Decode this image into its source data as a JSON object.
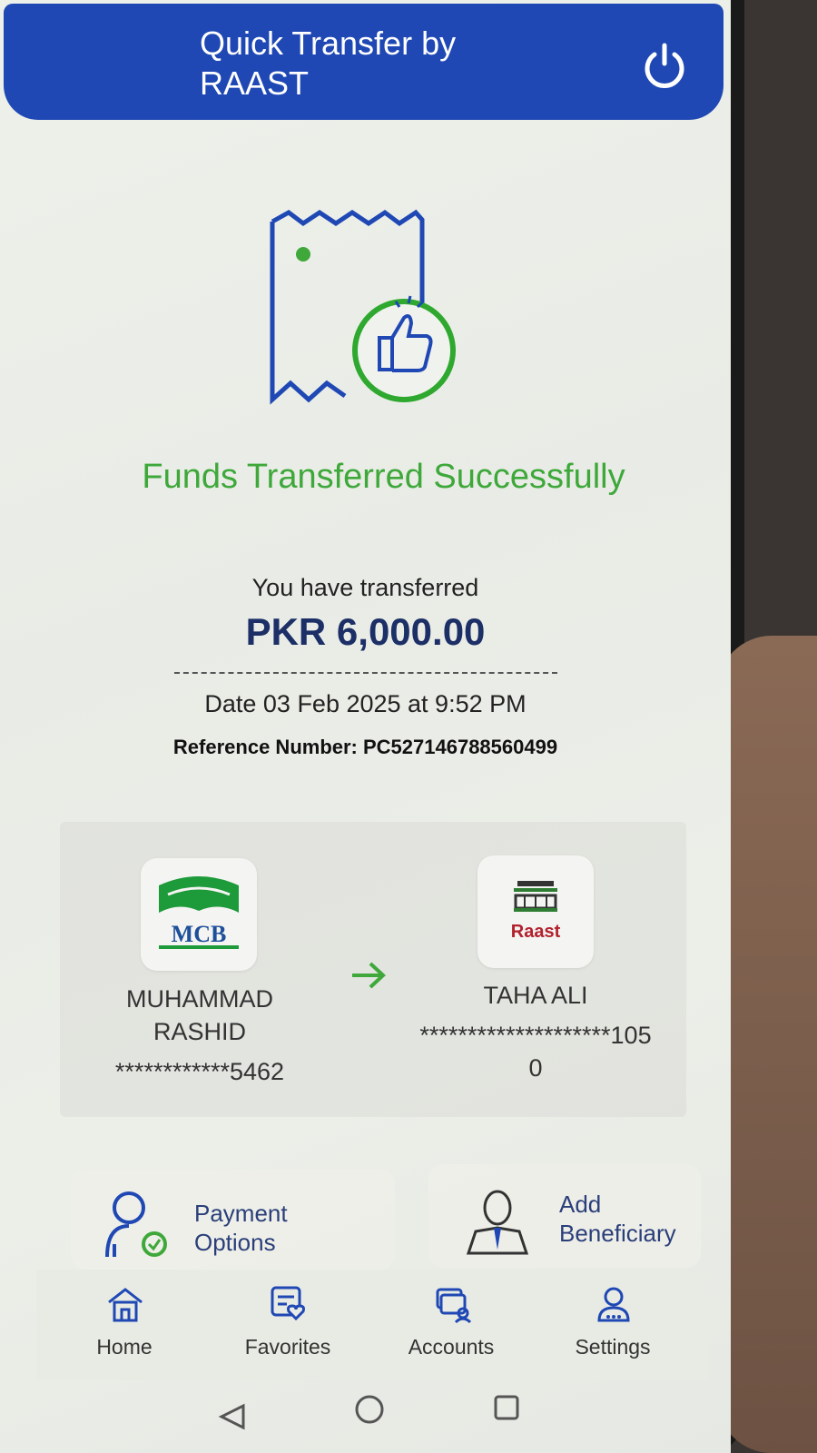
{
  "header": {
    "title": "Quick Transfer by RAAST",
    "power_icon": "power-icon"
  },
  "status": {
    "message": "Funds Transferred Successfully",
    "color": "#3ea83a"
  },
  "transfer": {
    "label": "You have transferred",
    "amount": "PKR 6,000.00",
    "date": "Date 03 Feb 2025 at 9:52 PM",
    "reference": "Reference Number: PC527146788560499"
  },
  "sender": {
    "bank": "MCB",
    "name": "MUHAMMAD RASHID",
    "account": "************5462"
  },
  "receiver": {
    "bank": "Raast",
    "name": "TAHA ALI",
    "account": "********************1050"
  },
  "actions": [
    {
      "label": "Payment Options",
      "icon": "payment-options-icon"
    },
    {
      "label": "Add Beneficiary",
      "icon": "add-beneficiary-icon"
    }
  ],
  "nav": [
    {
      "label": "Home",
      "icon": "home-icon"
    },
    {
      "label": "Favorites",
      "icon": "favorites-icon"
    },
    {
      "label": "Accounts",
      "icon": "accounts-icon"
    },
    {
      "label": "Settings",
      "icon": "settings-icon"
    }
  ],
  "colors": {
    "header": "#1f48b4",
    "amount": "#1c2f66",
    "accent_green": "#3ea83a"
  }
}
